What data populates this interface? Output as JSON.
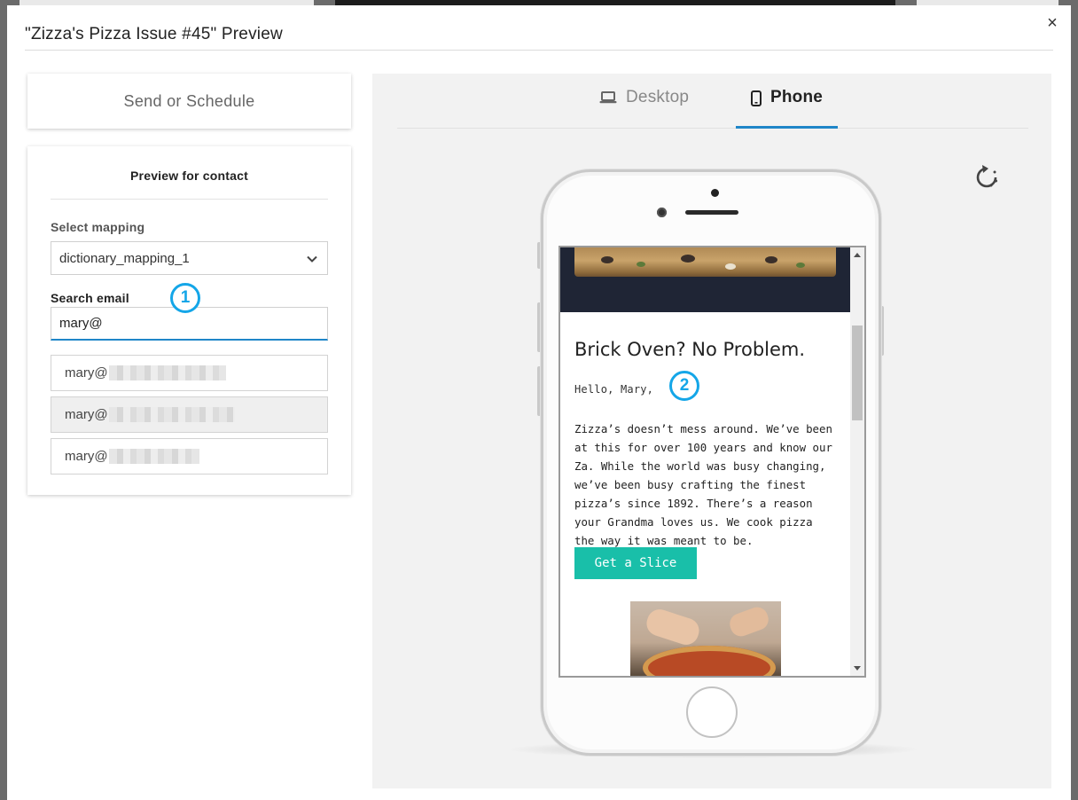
{
  "modal": {
    "title": "\"Zizza's Pizza Issue #45\" Preview",
    "close_label": "×"
  },
  "send": {
    "label": "Send or Schedule"
  },
  "contact_preview": {
    "title": "Preview for contact",
    "mapping_label": "Select mapping",
    "mapping_value": "dictionary_mapping_1",
    "search_label": "Search email",
    "search_value": "mary@",
    "results": [
      {
        "prefix": "mary@"
      },
      {
        "prefix": "mary@"
      },
      {
        "prefix": "mary@"
      }
    ],
    "badge": "1"
  },
  "tabs": {
    "desktop_label": "Desktop",
    "phone_label": "Phone",
    "active": "Phone"
  },
  "email": {
    "heading": "Brick Oven? No Problem.",
    "greeting": "Hello, Mary,",
    "body": "Zizza’s doesn’t mess around. We’ve been at this for over 100 years and know our Za. While the world was busy changing, we’ve been busy crafting the finest pizza’s since 1892. There’s a reason your Grandma loves us. We cook pizza the way it was meant to be.",
    "cta_label": "Get a Slice",
    "badge": "2"
  },
  "colors": {
    "accent": "#1f86c8",
    "badge": "#14a6e8",
    "cta": "#19bfa9",
    "hero_bg": "#1f2535"
  },
  "icons": {
    "close": "close-icon",
    "chevron": "chevron-down-icon",
    "desktop": "laptop-icon",
    "phone": "phone-icon",
    "rotate": "rotate-icon"
  }
}
